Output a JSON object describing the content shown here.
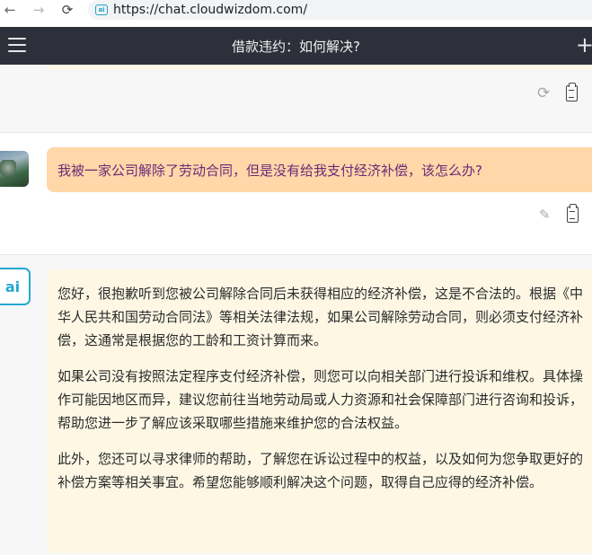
{
  "browser": {
    "back_icon": "←",
    "forward_icon": "→",
    "reload_icon": "⟳",
    "site_icon_label": "ai",
    "url": "https://chat.cloudwizdom.com/"
  },
  "header": {
    "title": "借款违约：如何解决?",
    "plus_icon": "+"
  },
  "messages": {
    "user": {
      "text": "我被一家公司解除了劳动合同，但是没有给我支付经济补偿，该怎么办?"
    },
    "ai": {
      "avatar_label": "ai",
      "paragraphs": [
        "您好，很抱歉听到您被公司解除合同后未获得相应的经济补偿，这是不合法的。根据《中华人民共和国劳动合同法》等相关法律法规，如果公司解除劳动合同，则必须支付经济补偿，这通常是根据您的工龄和工资计算而来。",
        "如果公司没有按照法定程序支付经济补偿，则您可以向相关部门进行投诉和维权。具体操作可能因地区而异，建议您前往当地劳动局或人力资源和社会保障部门进行咨询和投诉，帮助您进一步了解应该采取哪些措施来维护您的合法权益。",
        "此外，您还可以寻求律师的帮助，了解您在诉讼过程中的权益，以及如何为您争取更好的补偿方案等相关事宜。希望您能够顺利解决这个问题，取得自己应得的经济补偿。"
      ]
    }
  },
  "icons": {
    "refresh": "⟳",
    "edit": "✎"
  },
  "colors": {
    "header_bg": "#2d2f3a",
    "user_bubble": "#ffd7a9",
    "user_text": "#6b2a76",
    "ai_bubble": "#fdf7e4",
    "brand": "#22a9cf"
  }
}
